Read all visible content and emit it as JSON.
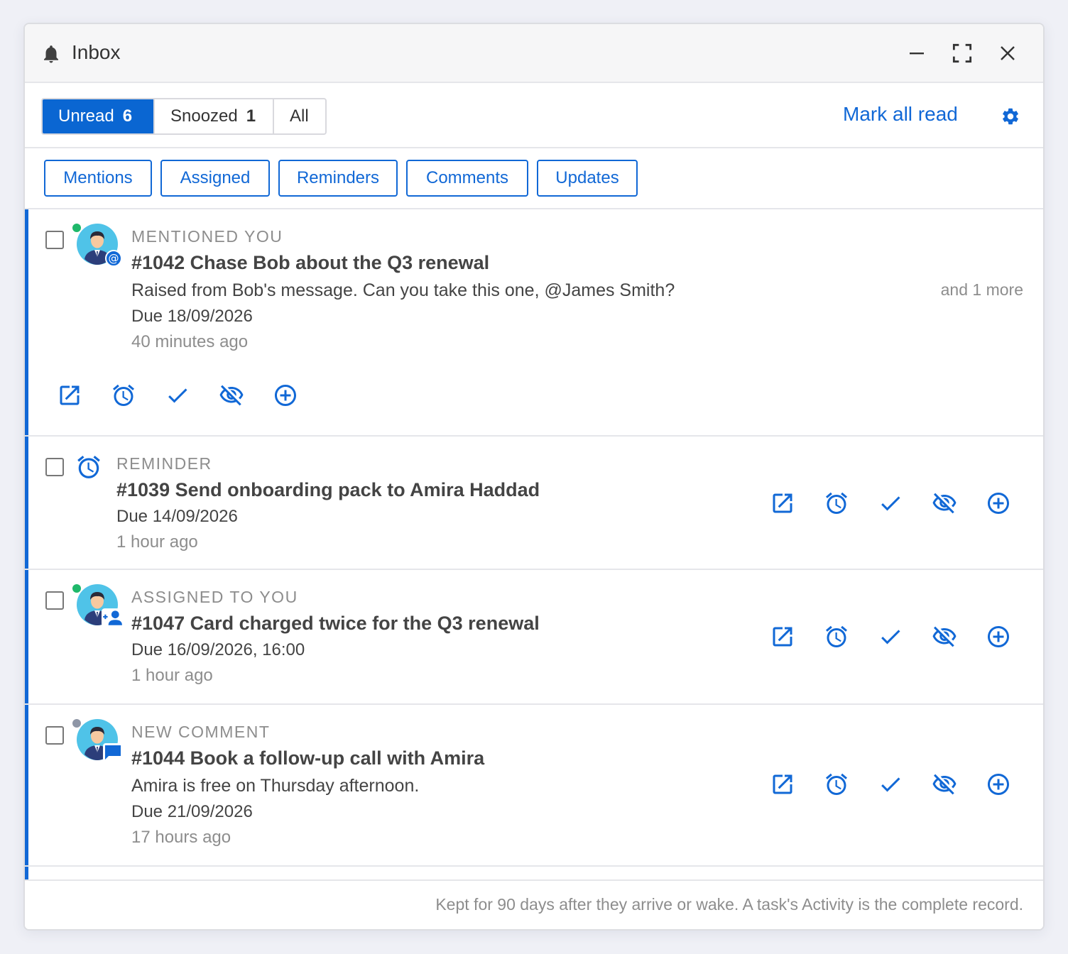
{
  "window": {
    "title": "Inbox"
  },
  "tabs": [
    {
      "label": "Unread",
      "count": "6"
    },
    {
      "label": "Snoozed",
      "count": "1"
    },
    {
      "label": "All"
    }
  ],
  "toolbar": {
    "mark_all_read": "Mark all read"
  },
  "filters": [
    "Mentions",
    "Assigned",
    "Reminders",
    "Comments",
    "Updates"
  ],
  "items": [
    {
      "kind": "MENTIONED YOU",
      "title": "#1042 Chase Bob about the Q3 renewal",
      "body": "Raised from Bob's message. Can you take this one, @James Smith?",
      "due": "Due 18/09/2026",
      "time": "40 minutes ago",
      "more": "and 1 more",
      "badge": "at-icon",
      "presence": "online"
    },
    {
      "kind": "REMINDER",
      "title": "#1039 Send onboarding pack to Amira Haddad",
      "due": "Due 14/09/2026",
      "time": "1 hour ago",
      "badge": "alarm-clock-icon"
    },
    {
      "kind": "ASSIGNED TO YOU",
      "title": "#1047 Card charged twice for the Q3 renewal",
      "due": "Due 16/09/2026, 16:00",
      "time": "1 hour ago",
      "badge": "person-add-icon",
      "presence": "online"
    },
    {
      "kind": "NEW COMMENT",
      "title": "#1044 Book a follow-up call with Amira",
      "body": "Amira is free on Thursday afternoon.",
      "due": "Due 21/09/2026",
      "time": "17 hours ago",
      "badge": "comment-icon",
      "presence": "away"
    }
  ],
  "footer": {
    "note": "Kept for 90 days after they arrive or wake. A task's Activity is the complete record."
  },
  "colors": {
    "accent": "#1168d6",
    "active_tab": "#0a66d2",
    "online": "#1fb86a",
    "away": "#8e96a6"
  }
}
